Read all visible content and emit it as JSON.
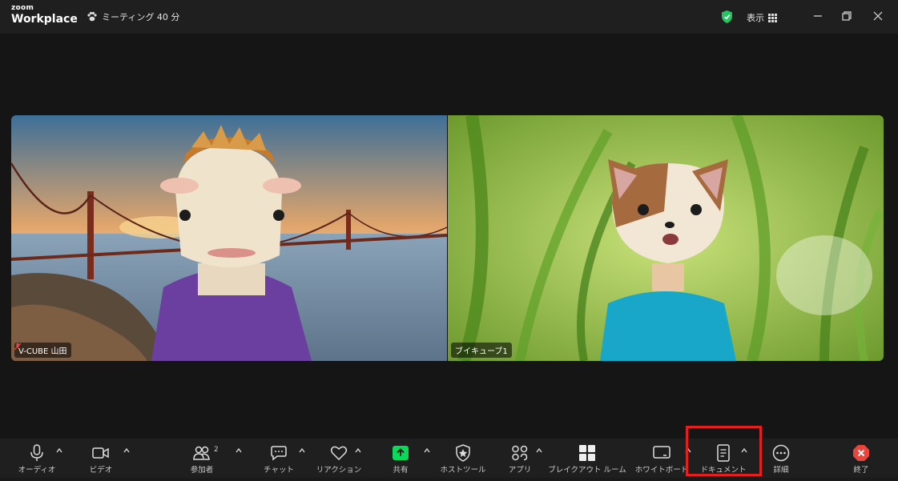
{
  "app": {
    "logo_top": "zoom",
    "logo_bottom": "Workplace"
  },
  "meeting": {
    "title": "ミーティング 40 分"
  },
  "header": {
    "view_label": "表示"
  },
  "participants": [
    {
      "name": "V-CUBE 山田",
      "muted": true,
      "avatar": "cow"
    },
    {
      "name": "ブイキューブ1",
      "muted": false,
      "avatar": "cat"
    }
  ],
  "toolbar": {
    "audio": "オーディオ",
    "video": "ビデオ",
    "participants": "参加者",
    "participants_count": "2",
    "chat": "チャット",
    "reactions": "リアクション",
    "share": "共有",
    "host_tools": "ホストツール",
    "apps": "アプリ",
    "breakout": "ブレイクアウト ルーム",
    "whiteboard": "ホワイトボード",
    "docs": "ドキュメント",
    "more": "詳細",
    "end": "終了"
  },
  "colors": {
    "share_green": "#0bd95a",
    "end_red": "#e8453c",
    "highlight_red": "#e61e1e",
    "shield_green": "#22c55e"
  }
}
